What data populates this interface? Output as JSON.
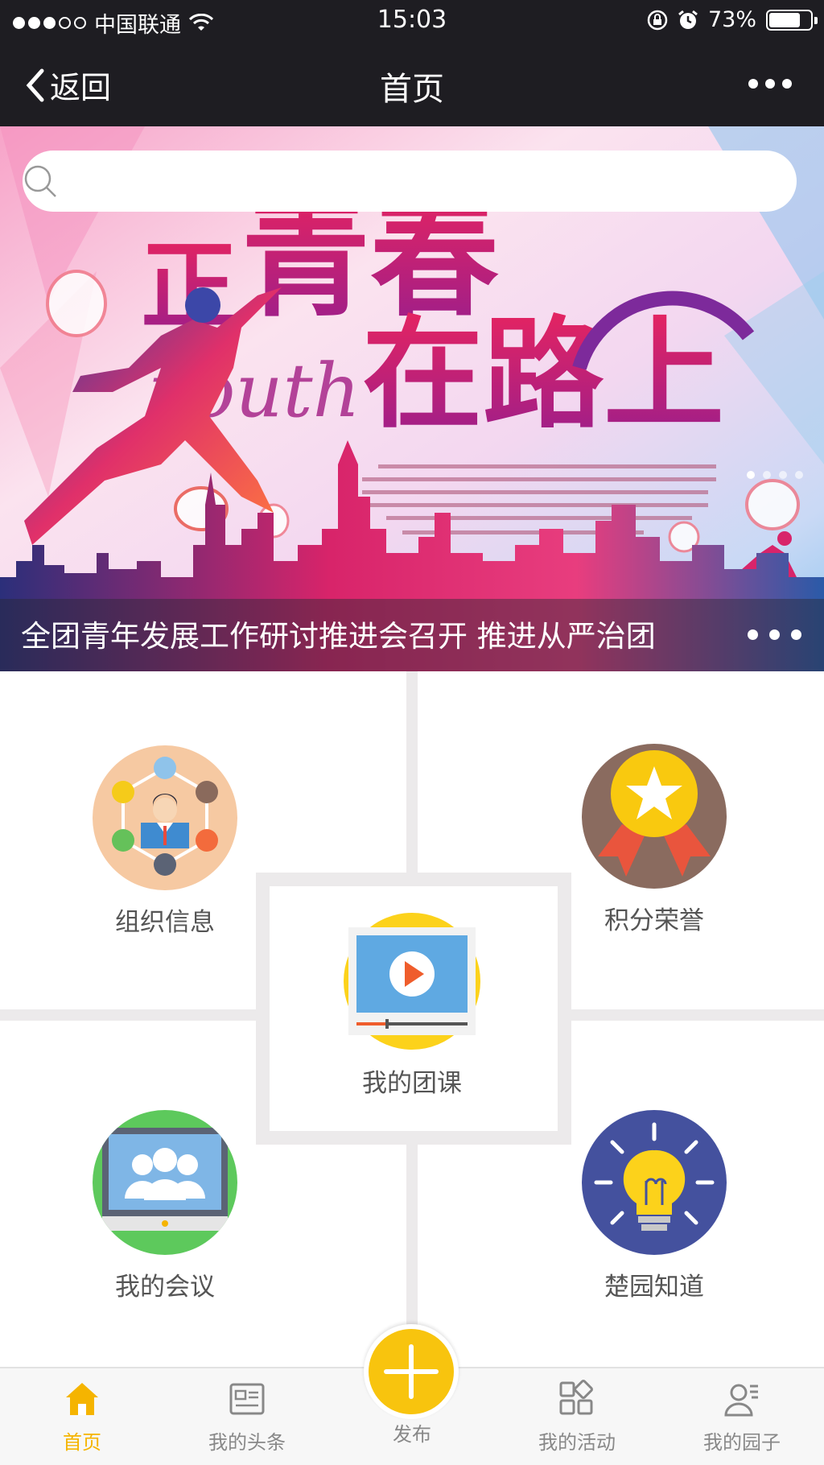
{
  "status_bar": {
    "carrier": "中国联通",
    "time": "15:03",
    "battery": "73%",
    "signal_dots_filled": 3,
    "signal_dots_total": 5
  },
  "navbar": {
    "back_label": "返回",
    "title": "首页"
  },
  "search": {
    "placeholder": ""
  },
  "banner": {
    "caption": "全团青年发展工作研讨推进会召开  推进从严治团",
    "headline": "正青春在路上",
    "headline_en": "youth",
    "slide_count": 4,
    "active_slide": 1
  },
  "grid": {
    "items": [
      {
        "label": "组织信息",
        "icon": "organization-icon"
      },
      {
        "label": "积分荣誉",
        "icon": "medal-icon"
      },
      {
        "label": "我的团课",
        "icon": "video-lesson-icon"
      },
      {
        "label": "我的会议",
        "icon": "meeting-icon"
      },
      {
        "label": "楚园知道",
        "icon": "lightbulb-icon"
      }
    ]
  },
  "tabbar": {
    "items": [
      {
        "label": "首页",
        "icon": "home-icon",
        "active": true
      },
      {
        "label": "我的头条",
        "icon": "news-icon",
        "active": false
      },
      {
        "label": "发布",
        "icon": "plus-icon",
        "active": false
      },
      {
        "label": "我的活动",
        "icon": "apps-icon",
        "active": false
      },
      {
        "label": "我的园子",
        "icon": "profile-icon",
        "active": false
      }
    ],
    "accent_color": "#f5b400"
  },
  "colors": {
    "header_bg": "#1e1d22",
    "accent_yellow": "#f8c40e",
    "divider": "#eceaeb"
  }
}
